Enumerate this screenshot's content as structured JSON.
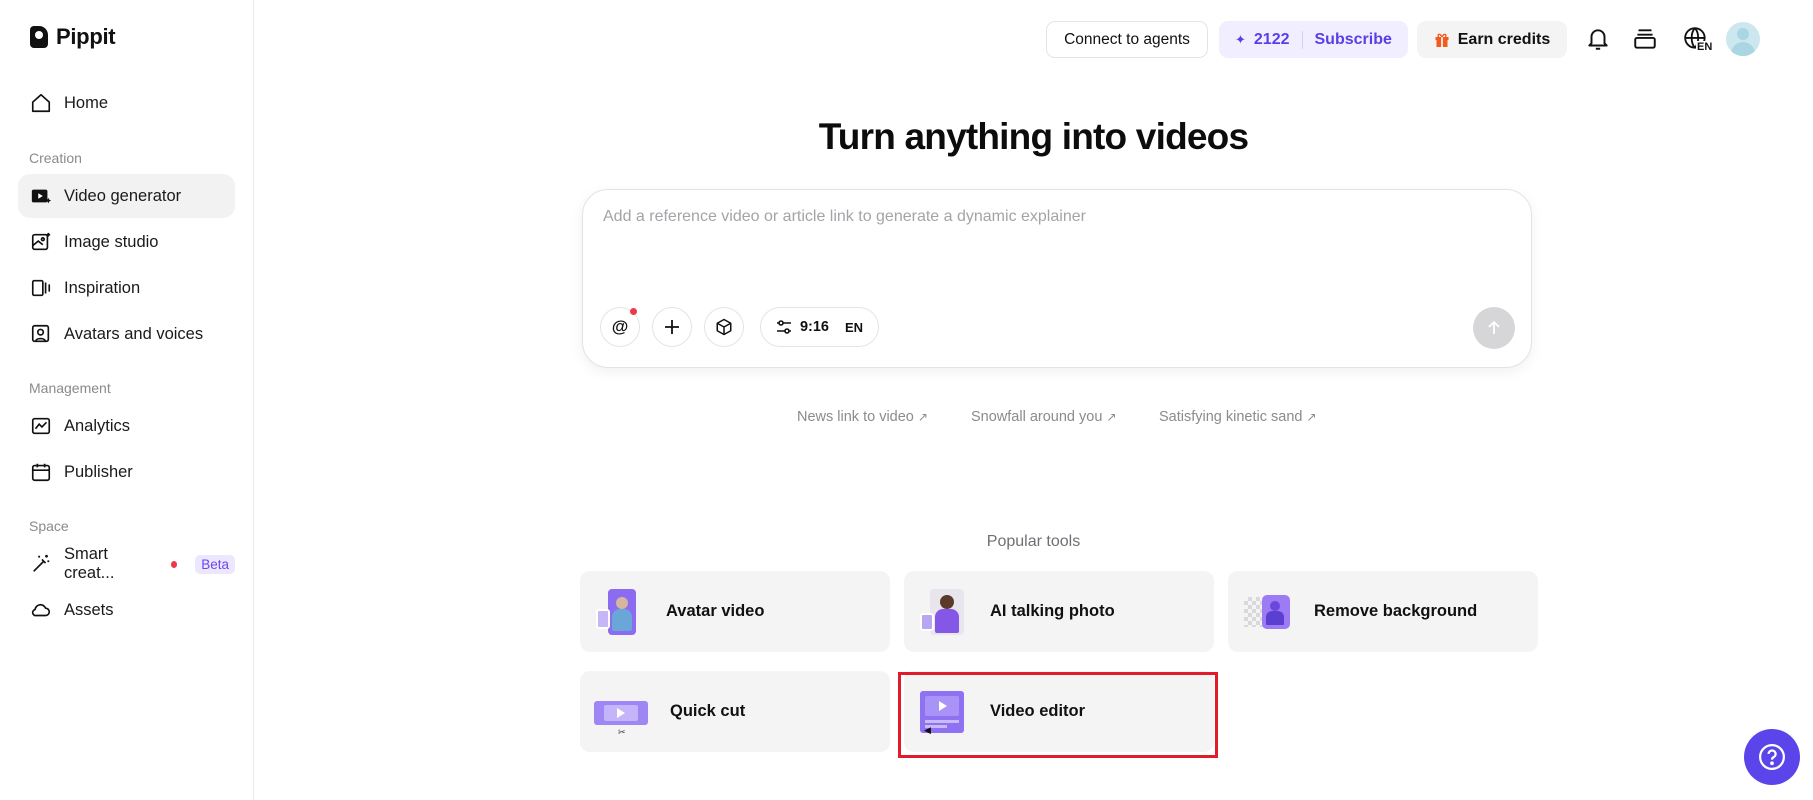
{
  "brand": {
    "name": "Pippit"
  },
  "sidebar": {
    "home": "Home",
    "sections": {
      "creation": "Creation",
      "management": "Management",
      "space": "Space"
    },
    "creation_items": [
      "Video generator",
      "Image studio",
      "Inspiration",
      "Avatars and voices"
    ],
    "management_items": [
      "Analytics",
      "Publisher"
    ],
    "space_items": [
      "Smart creat...",
      "Assets"
    ],
    "beta_badge": "Beta",
    "active_item": "Video generator"
  },
  "topbar": {
    "connect_label": "Connect to agents",
    "credits_count": "2122",
    "subscribe_label": "Subscribe",
    "earn_label": "Earn credits",
    "lang_badge": "EN"
  },
  "hero": {
    "title": "Turn anything into videos",
    "prompt_placeholder": "Add a reference video or article link to generate a dynamic explainer",
    "ratio": "9:16",
    "language": "EN"
  },
  "suggestions": [
    "News link to video",
    "Snowfall around you",
    "Satisfying kinetic sand"
  ],
  "popular": {
    "label": "Popular tools",
    "tools": [
      "Avatar video",
      "AI talking photo",
      "Remove background",
      "Quick cut",
      "Video editor"
    ]
  },
  "colors": {
    "accent": "#5b44ea",
    "highlight": "#e21b2b",
    "active_bg": "#f2f2f3",
    "card_bg": "#f4f4f5"
  }
}
